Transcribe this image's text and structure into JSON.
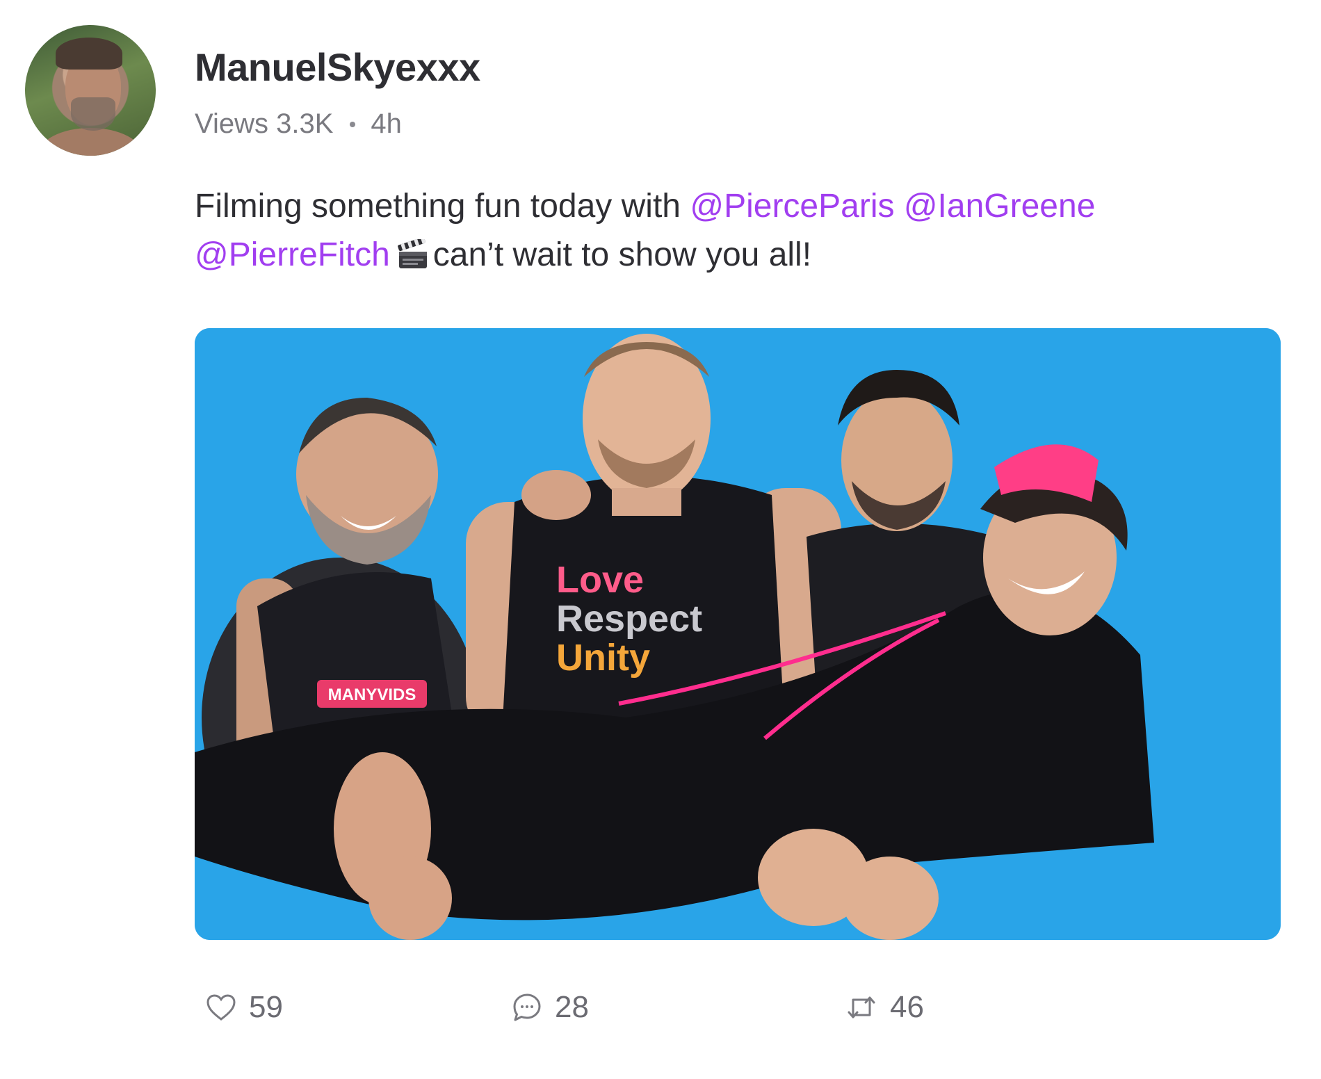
{
  "post": {
    "author": {
      "username": "ManuelSkyexxx",
      "avatar_icon": "author-avatar"
    },
    "meta": {
      "views": "Views 3.3K",
      "time": "4h"
    },
    "text": {
      "part1": "Filming something fun today with ",
      "mention1": "@PierceParis",
      "mention2": "@IanGreene",
      "mention3": "@PierreFitch",
      "emoji_icon": "clapper-board-icon",
      "part2": "can’t wait to show you all!"
    },
    "photo": {
      "shirt_brand": "MANYVIDS",
      "shirt_line1": "Love",
      "shirt_line2": "Respect",
      "shirt_line3": "Unity"
    },
    "actions": {
      "likes": "59",
      "comments": "28",
      "reposts": "46"
    }
  },
  "colors": {
    "mention": "#a13ef0",
    "photo_bg": "#2aa6ea",
    "text": "#2e2e33",
    "muted": "#7a7a80",
    "accent_pink": "#ff2d8e"
  }
}
